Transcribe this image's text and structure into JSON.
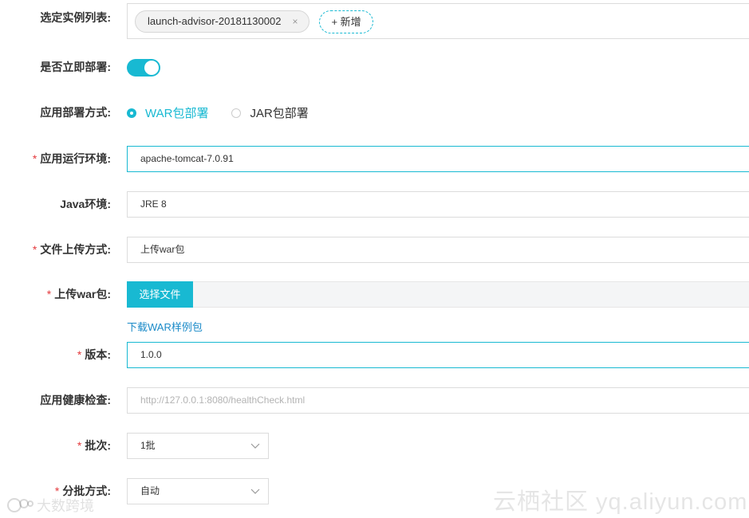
{
  "form": {
    "instances": {
      "label": "选定实例列表:",
      "tags": [
        "launch-advisor-20181130002"
      ],
      "remove_glyph": "×",
      "add_label": "+ 新增"
    },
    "deploy_now": {
      "label": "是否立即部署:",
      "enabled": true
    },
    "deploy_method": {
      "label": "应用部署方式:",
      "options": [
        {
          "label": "WAR包部署",
          "selected": true
        },
        {
          "label": "JAR包部署",
          "selected": false
        }
      ]
    },
    "runtime_env": {
      "required": true,
      "label": "应用运行环境:",
      "value": "apache-tomcat-7.0.91"
    },
    "java_env": {
      "label": "Java环境:",
      "value": "JRE 8"
    },
    "upload_method": {
      "required": true,
      "label": "文件上传方式:",
      "value": "上传war包"
    },
    "upload_war": {
      "required": true,
      "label": "上传war包:",
      "button_label": "选择文件",
      "download_link": "下载WAR样例包"
    },
    "version": {
      "required": true,
      "label": "版本:",
      "value": "1.0.0"
    },
    "health_check": {
      "label": "应用健康检查:",
      "placeholder": "http://127.0.0.1:8080/healthCheck.html"
    },
    "batch": {
      "required": true,
      "label": "批次:",
      "value": "1批"
    },
    "batch_method": {
      "required": true,
      "label": "分批方式:",
      "value": "自动"
    }
  },
  "watermarks": {
    "right": "云栖社区 yq.aliyun.com",
    "left": "大数跨境"
  },
  "colors": {
    "accent": "#18b9d2",
    "required": "#e4393c",
    "link": "#1a8ac8"
  },
  "req_mark": "*"
}
